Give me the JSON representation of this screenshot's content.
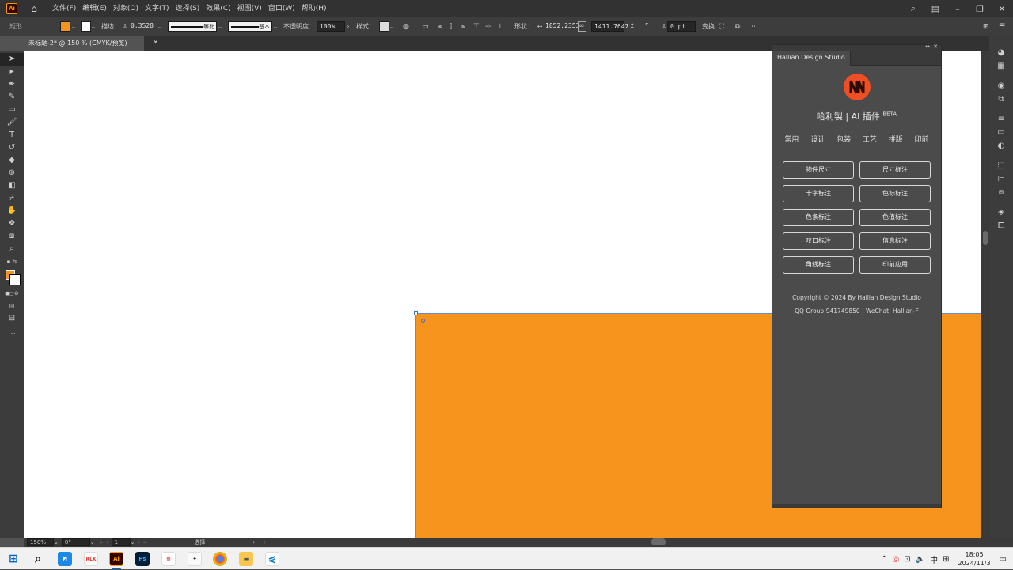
{
  "app": {
    "logo_text": "Ai",
    "menu": [
      "文件(F)",
      "编辑(E)",
      "对象(O)",
      "文字(T)",
      "选择(S)",
      "效果(C)",
      "视图(V)",
      "窗口(W)",
      "帮助(H)"
    ]
  },
  "control": {
    "object_type": "矩形",
    "stroke_label": "描边：",
    "stroke_value": "0.3528",
    "stroke_profile": "等比",
    "brush": "基本",
    "opacity_label": "不透明度：",
    "opacity_value": "100%",
    "style_label": "样式：",
    "shape_label": "形状：",
    "width": "1852.2353",
    "height": "1411.7647",
    "corner": "0 pt",
    "transform_label": "变换"
  },
  "document": {
    "tab_title": "未标题-2* @ 150 % (CMYK/预览)",
    "fill_color": "#f7941d"
  },
  "plugin": {
    "panel_tab": "Hallian Design Studio",
    "title": "哈利製 | AI 插件",
    "badge": "BETA",
    "tabs": [
      "常用",
      "设计",
      "包装",
      "工艺",
      "拼版",
      "印前"
    ],
    "buttons": [
      "物件尺寸",
      "尺寸标注",
      "十字标注",
      "色标标注",
      "色条标注",
      "色值标注",
      "咬口标注",
      "信息标注",
      "角线标注",
      "印前应用"
    ],
    "copyright": "Copyright © 2024 By Hallian Design Studio",
    "contact": "QQ Group:941749850 | WeChat: Hallian-F"
  },
  "status": {
    "zoom": "150%",
    "rotate": "0°",
    "artboard": "1",
    "tool": "选择"
  },
  "taskbar": {
    "ime": "中",
    "time": "18:05",
    "date": "2024/11/3"
  }
}
